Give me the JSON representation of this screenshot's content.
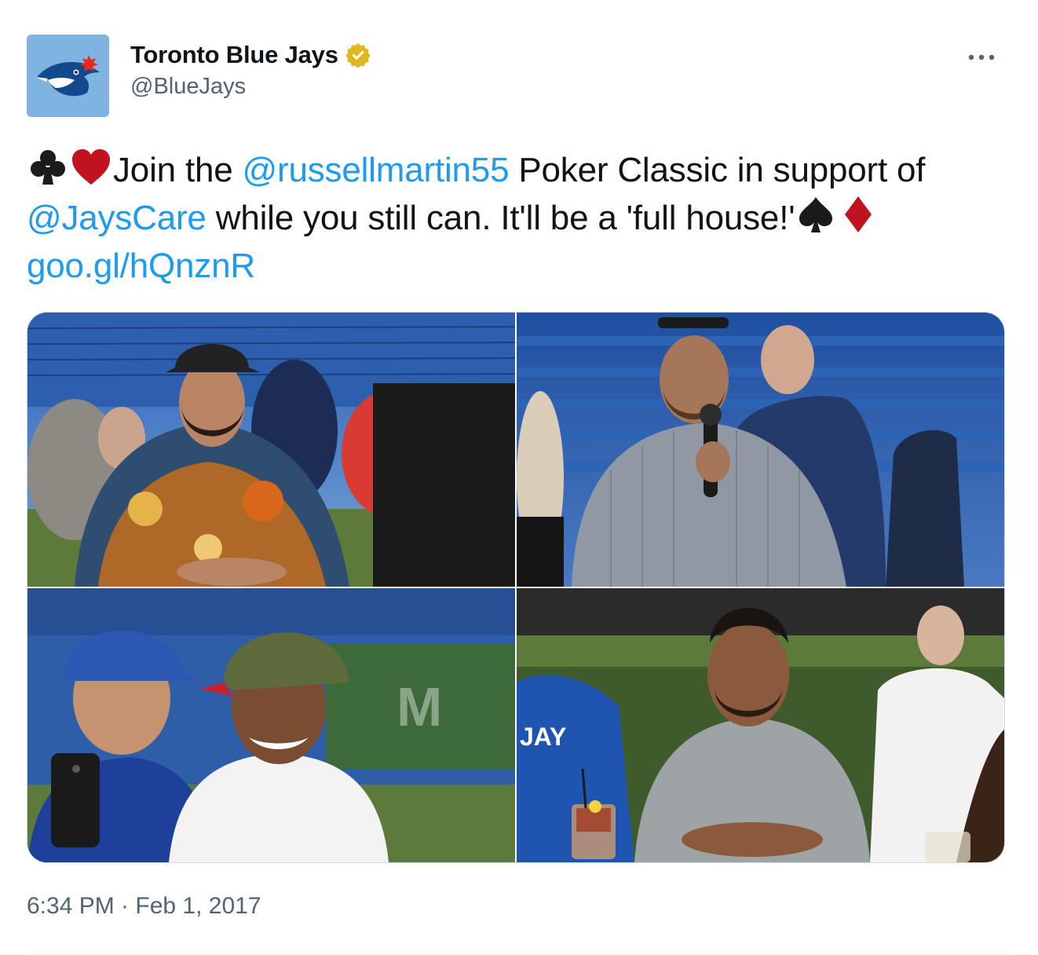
{
  "author": {
    "display_name": "Toronto Blue Jays",
    "handle": "@BlueJays",
    "verified": true,
    "avatar_icon": "blue-jays-logo-icon",
    "verified_icon": "verified-badge-icon"
  },
  "menu": {
    "icon": "more-options-icon"
  },
  "tweet": {
    "text_join": "Join the ",
    "mention_1": "@russellmartin55",
    "text_mid_1": " Poker Classic in support of ",
    "mention_2": "@JaysCare",
    "text_mid_2": " while you still can. It'll be a 'full house!'",
    "link": "goo.gl/hQnznR",
    "suits": [
      "club",
      "heart",
      "spade",
      "diamond"
    ]
  },
  "media": {
    "photos": [
      {
        "icon": "photo-player-poker-table"
      },
      {
        "icon": "photo-player-microphone"
      },
      {
        "icon": "photo-selfie-fans"
      },
      {
        "icon": "photo-player-playing-cards"
      }
    ]
  },
  "meta": {
    "timestamp": "6:34 PM · Feb 1, 2017"
  },
  "colors": {
    "link": "#1d9bf0",
    "muted": "#536471",
    "suit_red": "#c1121f",
    "suit_black": "#1b1b1b",
    "avatar_bg": "#7fb4e0"
  }
}
